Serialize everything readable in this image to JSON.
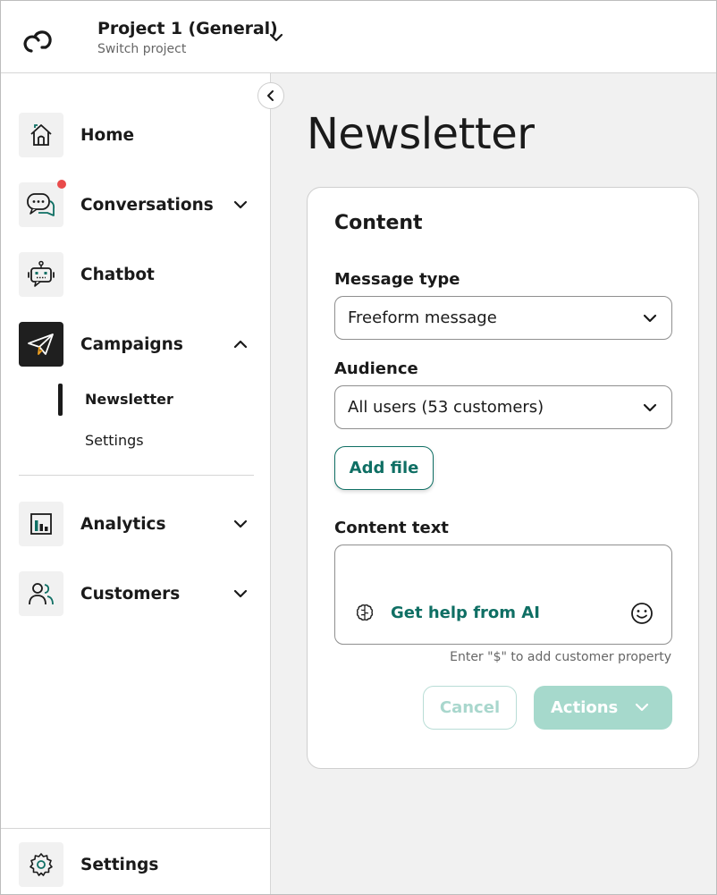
{
  "header": {
    "project_title": "Project 1 (General)",
    "project_subtitle": "Switch project"
  },
  "sidebar": {
    "items": [
      {
        "label": "Home",
        "icon": "home-icon"
      },
      {
        "label": "Conversations",
        "icon": "chat-bubbles-icon",
        "has_notification": true
      },
      {
        "label": "Chatbot",
        "icon": "robot-icon"
      },
      {
        "label": "Campaigns",
        "icon": "paper-plane-icon",
        "expanded": true,
        "active": true
      },
      {
        "label": "Analytics",
        "icon": "bar-chart-icon"
      },
      {
        "label": "Customers",
        "icon": "users-icon"
      }
    ],
    "campaign_subitems": [
      {
        "label": "Newsletter",
        "active": true
      },
      {
        "label": "Settings"
      }
    ],
    "bottom_item": {
      "label": "Settings",
      "icon": "gear-icon"
    }
  },
  "main": {
    "page_title": "Newsletter",
    "card": {
      "title": "Content",
      "message_type": {
        "label": "Message type",
        "value": "Freeform message"
      },
      "audience": {
        "label": "Audience",
        "value": "All users (53 customers)"
      },
      "add_file_label": "Add file",
      "content_text": {
        "label": "Content text",
        "ai_help_label": "Get help from AI",
        "hint": "Enter \"$\" to add customer property"
      },
      "cancel_label": "Cancel",
      "actions_label": "Actions"
    }
  },
  "colors": {
    "accent": "#0f6f64",
    "accent_disabled": "#a6d9cc",
    "notification": "#e94b4b",
    "active_nav_bg": "#1f1f1f",
    "campaign_icon_accent": "#f0a020"
  }
}
